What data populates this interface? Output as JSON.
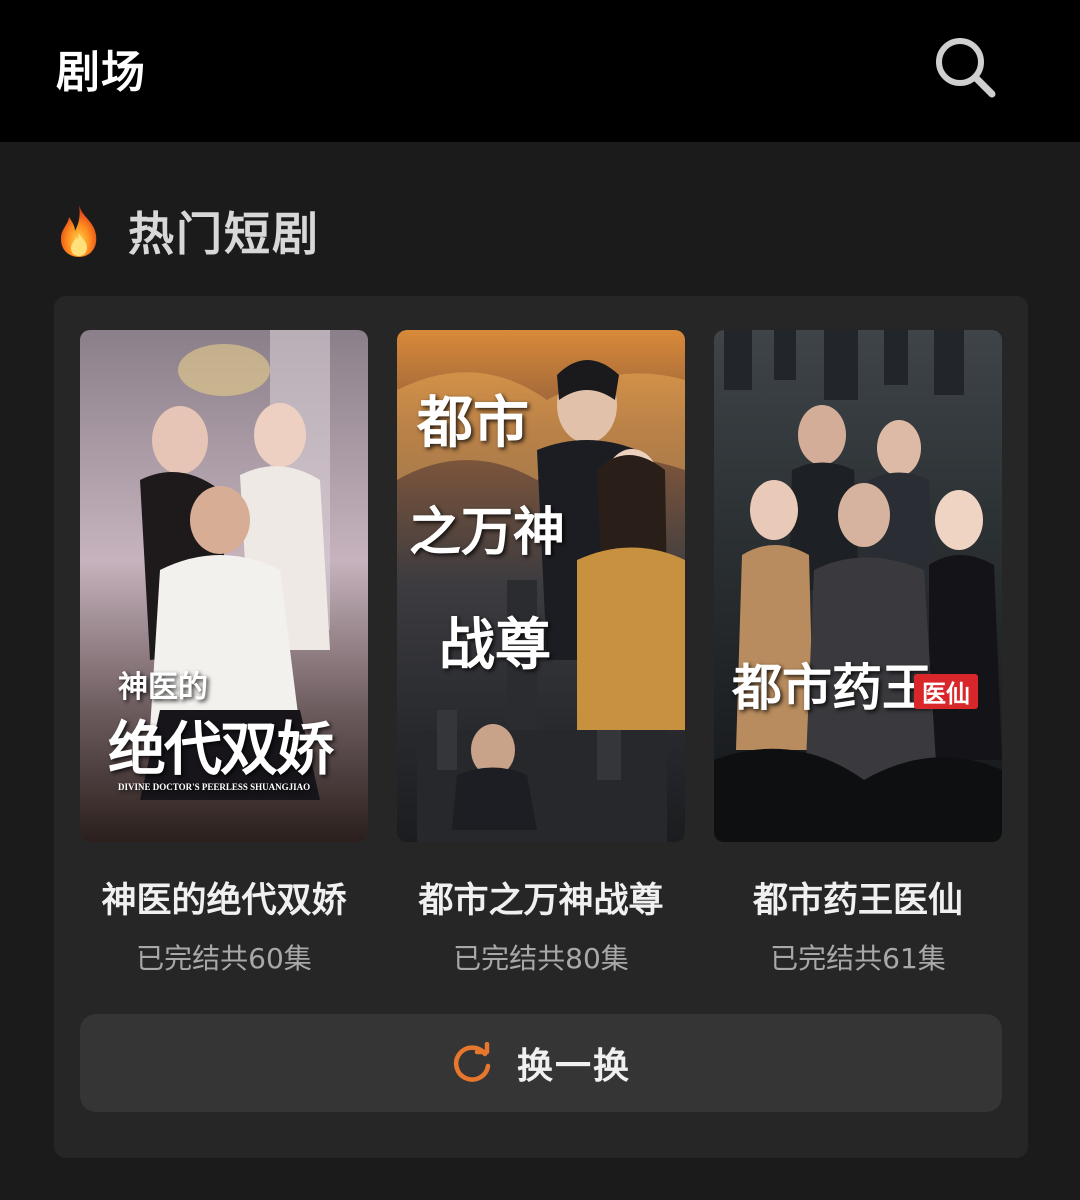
{
  "header": {
    "title": "剧场",
    "search_icon": "search-icon"
  },
  "section": {
    "icon": "fire-icon",
    "title": "热门短剧"
  },
  "dramas": [
    {
      "title": "神医的绝代双娇",
      "meta": "已完结共60集",
      "poster_title_small": "神医的",
      "poster_title_large": "绝代双娇",
      "poster_subtitle": "DIVINE DOCTOR'S PEERLESS SHUANGJIAO"
    },
    {
      "title": "都市之万神战尊",
      "meta": "已完结共80集",
      "poster_title_line1": "都市",
      "poster_title_line2": "之万神",
      "poster_title_line3": "战尊"
    },
    {
      "title": "都市药王医仙",
      "meta": "已完结共61集",
      "poster_title_main": "都市药王",
      "poster_title_tag": "医仙"
    }
  ],
  "refresh_button": {
    "label": "换一换",
    "icon": "refresh-icon"
  },
  "colors": {
    "accent": "#e8772e",
    "background": "#1b1b1b",
    "card": "#262626",
    "button": "#353535"
  }
}
